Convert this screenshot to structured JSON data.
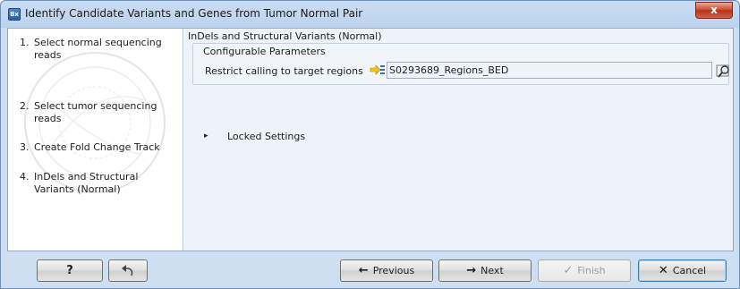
{
  "window": {
    "title": "Identify Candidate Variants and Genes from Tumor Normal Pair",
    "app_icon_text": "Bx",
    "close_symbol": "x"
  },
  "steps": [
    {
      "num": "1.",
      "label": "Select normal sequencing reads"
    },
    {
      "num": "2.",
      "label": "Select tumor sequencing reads"
    },
    {
      "num": "3.",
      "label": "Create Fold Change Track"
    },
    {
      "num": "4.",
      "label": "InDels and Structural Variants (Normal)"
    }
  ],
  "panel": {
    "title": "InDels and Structural Variants (Normal)",
    "group_label": "Configurable Parameters",
    "param_label": "Restrict calling to target regions",
    "param_value": "S0293689_Regions_BED",
    "locked_label": "Locked Settings",
    "locked_arrow": "▸"
  },
  "buttons": {
    "help": "?",
    "previous": "Previous",
    "next": "Next",
    "finish": "Finish",
    "cancel": "Cancel"
  },
  "icons": {
    "previous": "←",
    "next": "→",
    "finish": "✓",
    "cancel": "✕"
  }
}
